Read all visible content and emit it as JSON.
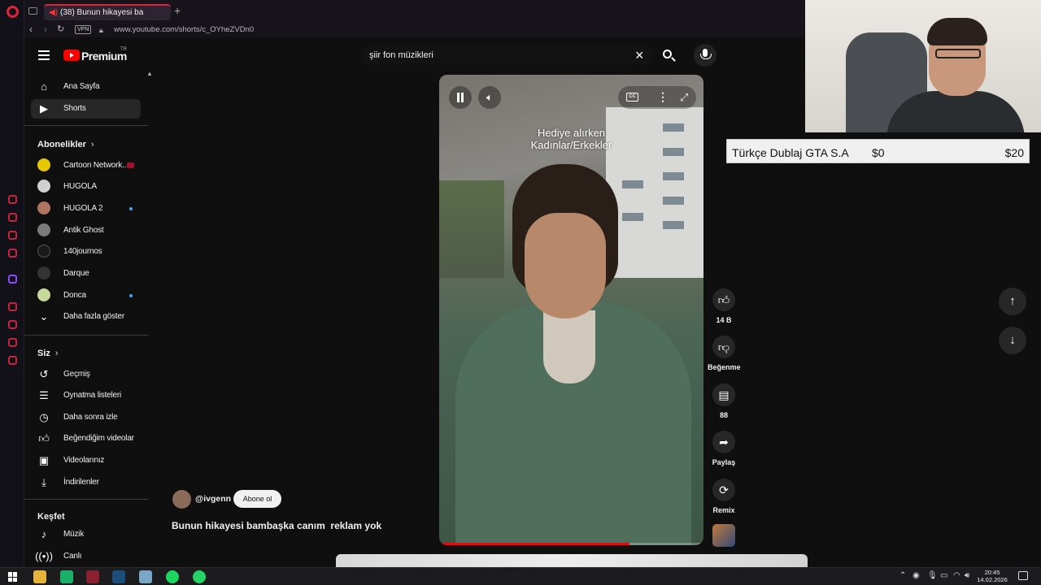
{
  "browser": {
    "tab_title": "(38) Bunun hikayesi ba",
    "new_tab": "+",
    "vpn": "VPN",
    "url": "www.youtube.com/shorts/c_OYheZVDn0",
    "rail_accent": "#e0223a"
  },
  "header": {
    "brand": "Premium",
    "region": "TR",
    "search_query": "şiir fon müzikleri"
  },
  "sidebar": {
    "main": [
      {
        "label": "Ana Sayfa",
        "icon": "home-icon"
      },
      {
        "label": "Shorts",
        "icon": "shorts-icon",
        "active": true
      }
    ],
    "subscriptions_title": "Abonelikler",
    "subscriptions": [
      {
        "label": "Cartoon Network...",
        "live": true
      },
      {
        "label": "HUGOLA"
      },
      {
        "label": "HUGOLA 2",
        "new": true
      },
      {
        "label": "Antik Ghost"
      },
      {
        "label": "140journos"
      },
      {
        "label": "Darque"
      },
      {
        "label": "Donca",
        "new": true
      }
    ],
    "show_more": "Daha fazla göster",
    "you_title": "Siz",
    "you": [
      {
        "label": "Geçmiş",
        "icon": "history-icon"
      },
      {
        "label": "Oynatma listeleri",
        "icon": "playlist-icon"
      },
      {
        "label": "Daha sonra izle",
        "icon": "clock-icon"
      },
      {
        "label": "Beğendiğim videolar",
        "icon": "like-icon"
      },
      {
        "label": "Videolarınız",
        "icon": "video-icon"
      },
      {
        "label": "İndirilenler",
        "icon": "download-icon"
      }
    ],
    "explore_title": "Keşfet",
    "explore": [
      {
        "label": "Müzik",
        "icon": "music-icon"
      },
      {
        "label": "Canlı",
        "icon": "live-icon"
      }
    ]
  },
  "short": {
    "overlay_text": "Hediye alırken\nKadınlar/Erkekler",
    "channel": "@ivgenn",
    "subscribe": "Abone ol",
    "title": "Bunun hikayesi bambaşka canım  reklam yok",
    "progress": 0.72,
    "cc_label": "CC"
  },
  "actions": {
    "like_count": "14 B",
    "dislike": "Beğenme",
    "comments": "88",
    "share": "Paylaş",
    "remix": "Remix"
  },
  "donation": {
    "name": "Türkçe Dublaj GTA S.A",
    "current": "$0",
    "goal": "$20"
  },
  "taskbar": {
    "time": "20:45",
    "date": "14.02.2026"
  },
  "colors": {
    "youtube_red": "#ff0000",
    "accent_blue": "#3ea6ff"
  }
}
